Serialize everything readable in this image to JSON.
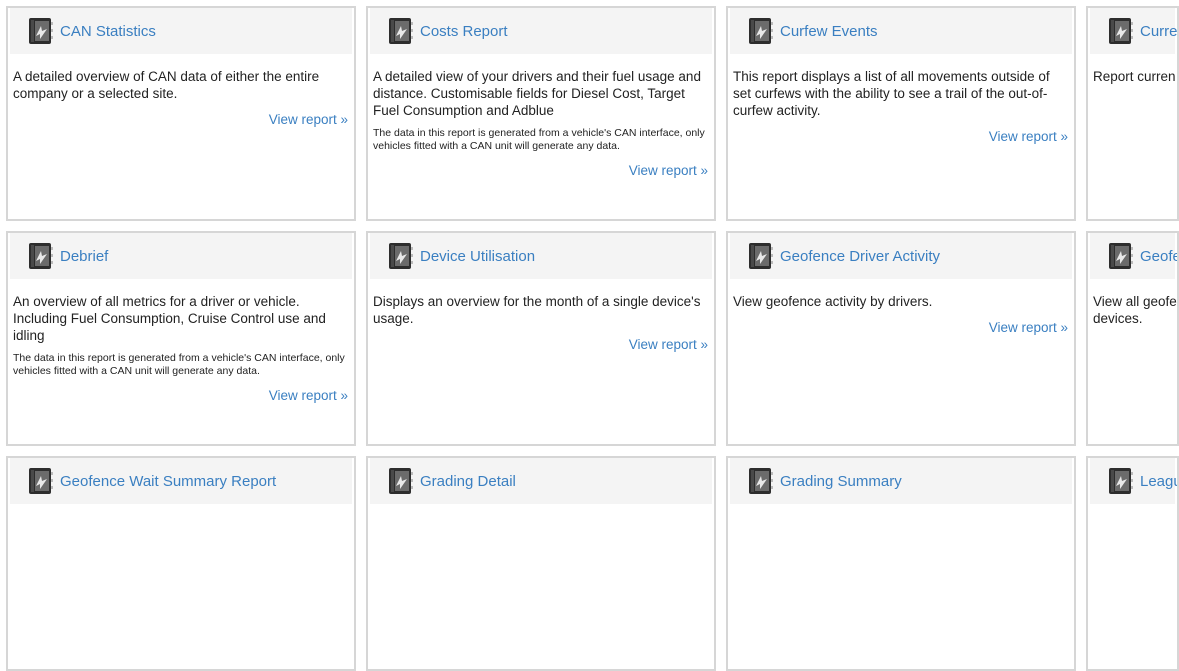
{
  "link_label": "View report »",
  "cards": [
    {
      "title": "CAN Statistics",
      "desc": "A detailed overview of CAN data of either the entire company or a selected site.",
      "note": ""
    },
    {
      "title": "Costs Report",
      "desc": "A detailed view of your drivers and their fuel usage and distance. Customisable fields for Diesel Cost, Target Fuel Consumption and Adblue",
      "note": "The data in this report is generated from a vehicle's CAN interface, only vehicles fitted with a CAN unit will generate any data."
    },
    {
      "title": "Curfew Events",
      "desc": "This report displays a list of all movements outside of set curfews with the ability to see a trail of the out-of-curfew activity.",
      "note": ""
    },
    {
      "title": "Currer",
      "desc": "Report curren",
      "note": ""
    },
    {
      "title": "Debrief",
      "desc": "An overview of all metrics for a driver or vehicle. Including Fuel Consumption, Cruise Control use and idling",
      "note": "The data in this report is generated from a vehicle's CAN interface, only vehicles fitted with a CAN unit will generate any data."
    },
    {
      "title": "Device Utilisation",
      "desc": "Displays an overview for the month of a single device's usage.",
      "note": ""
    },
    {
      "title": "Geofence Driver Activity",
      "desc": "View geofence activity by drivers.",
      "note": ""
    },
    {
      "title": "Geofe",
      "desc": "View all geofe devices.",
      "note": ""
    },
    {
      "title": "Geofence Wait Summary Report",
      "desc": "",
      "note": ""
    },
    {
      "title": "Grading Detail",
      "desc": "",
      "note": ""
    },
    {
      "title": "Grading Summary",
      "desc": "",
      "note": ""
    },
    {
      "title": "Leagu",
      "desc": "",
      "note": ""
    }
  ]
}
